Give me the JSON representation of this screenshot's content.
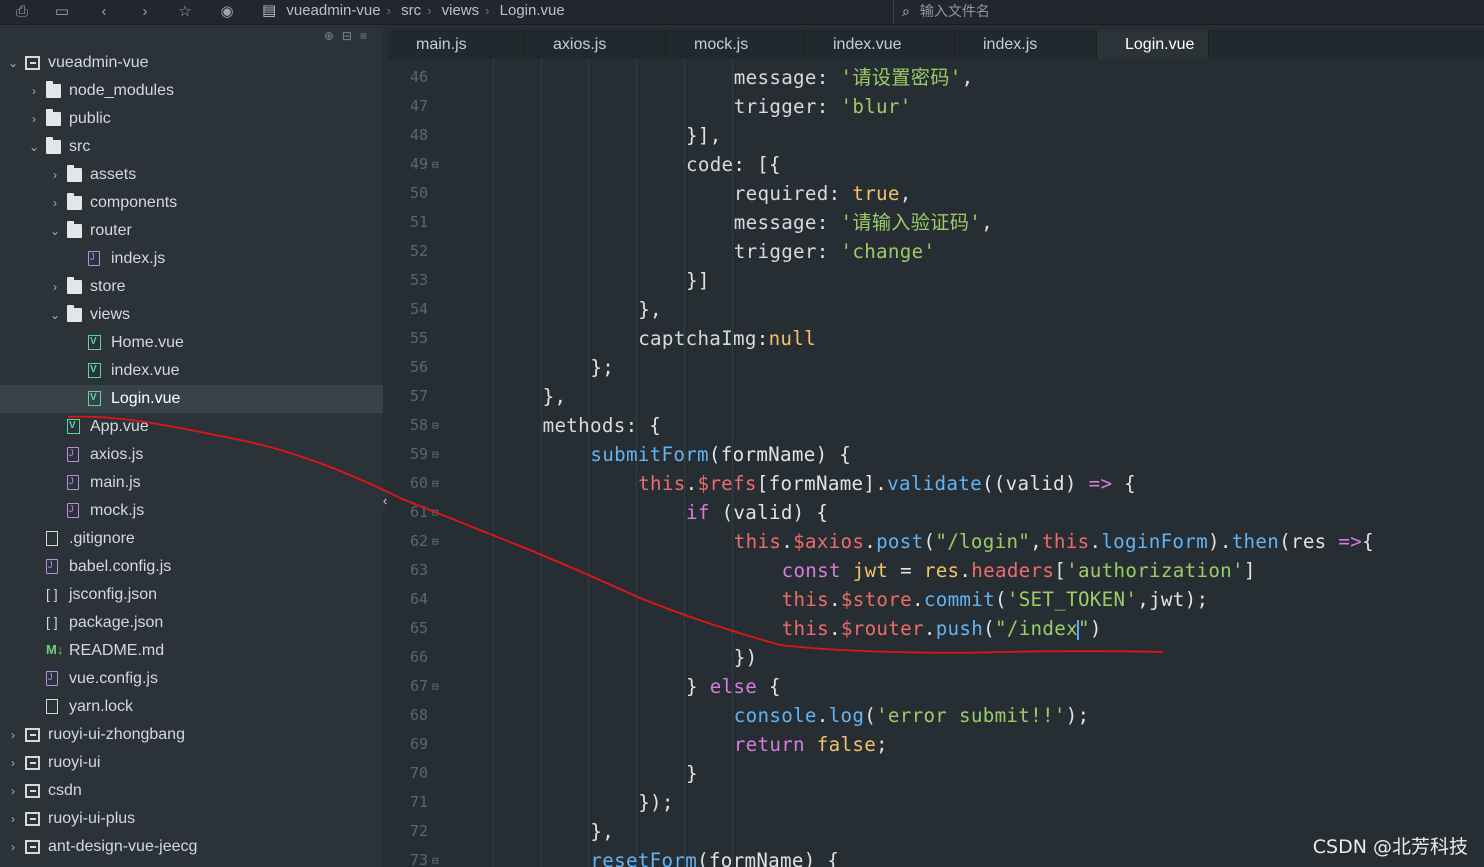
{
  "toolbar": {
    "breadcrumbs": [
      "vueadmin-vue",
      "src",
      "views",
      "Login.vue"
    ],
    "file_search_placeholder": "输入文件名"
  },
  "sidebar": {
    "items": [
      {
        "label": "vueadmin-vue",
        "type": "project",
        "depth": 0,
        "expanded": true
      },
      {
        "label": "node_modules",
        "type": "folder",
        "depth": 1,
        "expanded": false
      },
      {
        "label": "public",
        "type": "folder",
        "depth": 1,
        "expanded": false
      },
      {
        "label": "src",
        "type": "folder",
        "depth": 1,
        "expanded": true
      },
      {
        "label": "assets",
        "type": "folder",
        "depth": 2,
        "expanded": false
      },
      {
        "label": "components",
        "type": "folder",
        "depth": 2,
        "expanded": false
      },
      {
        "label": "router",
        "type": "folder",
        "depth": 2,
        "expanded": true
      },
      {
        "label": "index.js",
        "type": "js",
        "depth": 3
      },
      {
        "label": "store",
        "type": "folder",
        "depth": 2,
        "expanded": false
      },
      {
        "label": "views",
        "type": "folder",
        "depth": 2,
        "expanded": true
      },
      {
        "label": "Home.vue",
        "type": "vue",
        "depth": 3
      },
      {
        "label": "index.vue",
        "type": "vue",
        "depth": 3
      },
      {
        "label": "Login.vue",
        "type": "vue",
        "depth": 3,
        "selected": true
      },
      {
        "label": "App.vue",
        "type": "vue",
        "depth": 2
      },
      {
        "label": "axios.js",
        "type": "js",
        "depth": 2
      },
      {
        "label": "main.js",
        "type": "js",
        "depth": 2
      },
      {
        "label": "mock.js",
        "type": "js",
        "depth": 2
      },
      {
        "label": ".gitignore",
        "type": "file",
        "depth": 1
      },
      {
        "label": "babel.config.js",
        "type": "js",
        "depth": 1
      },
      {
        "label": "jsconfig.json",
        "type": "json",
        "depth": 1
      },
      {
        "label": "package.json",
        "type": "json",
        "depth": 1
      },
      {
        "label": "README.md",
        "type": "md",
        "depth": 1
      },
      {
        "label": "vue.config.js",
        "type": "js",
        "depth": 1
      },
      {
        "label": "yarn.lock",
        "type": "file",
        "depth": 1
      },
      {
        "label": "ruoyi-ui-zhongbang",
        "type": "project",
        "depth": 0,
        "expanded": false
      },
      {
        "label": "ruoyi-ui",
        "type": "project",
        "depth": 0,
        "expanded": false
      },
      {
        "label": "csdn",
        "type": "project",
        "depth": 0,
        "expanded": false
      },
      {
        "label": "ruoyi-ui-plus",
        "type": "project",
        "depth": 0,
        "expanded": false
      },
      {
        "label": "ant-design-vue-jeecg",
        "type": "project",
        "depth": 0,
        "expanded": false
      }
    ]
  },
  "tabs": [
    {
      "label": "main.js",
      "active": false
    },
    {
      "label": "axios.js",
      "active": false
    },
    {
      "label": "mock.js",
      "active": false
    },
    {
      "label": "index.vue",
      "active": false
    },
    {
      "label": "index.js",
      "active": false
    },
    {
      "label": "Login.vue",
      "active": true
    }
  ],
  "editor": {
    "lines": [
      {
        "n": "46",
        "fold": false,
        "indent": 6,
        "tokens": [
          [
            "key",
            "message"
          ],
          [
            "p",
            ": "
          ],
          [
            "str",
            "'请设置密码'"
          ],
          [
            "p",
            ","
          ]
        ]
      },
      {
        "n": "47",
        "fold": false,
        "indent": 6,
        "tokens": [
          [
            "key",
            "trigger"
          ],
          [
            "p",
            ": "
          ],
          [
            "str",
            "'blur'"
          ]
        ]
      },
      {
        "n": "48",
        "fold": false,
        "indent": 5,
        "tokens": [
          [
            "p",
            "}],"
          ]
        ]
      },
      {
        "n": "49",
        "fold": true,
        "indent": 5,
        "tokens": [
          [
            "key",
            "code"
          ],
          [
            "p",
            ": [{"
          ]
        ]
      },
      {
        "n": "50",
        "fold": false,
        "indent": 6,
        "tokens": [
          [
            "key",
            "required"
          ],
          [
            "p",
            ": "
          ],
          [
            "bool",
            "true"
          ],
          [
            "p",
            ","
          ]
        ]
      },
      {
        "n": "51",
        "fold": false,
        "indent": 6,
        "tokens": [
          [
            "key",
            "message"
          ],
          [
            "p",
            ": "
          ],
          [
            "str",
            "'请输入验证码'"
          ],
          [
            "p",
            ","
          ]
        ]
      },
      {
        "n": "52",
        "fold": false,
        "indent": 6,
        "tokens": [
          [
            "key",
            "trigger"
          ],
          [
            "p",
            ": "
          ],
          [
            "str",
            "'change'"
          ]
        ]
      },
      {
        "n": "53",
        "fold": false,
        "indent": 5,
        "tokens": [
          [
            "p",
            "}]"
          ]
        ]
      },
      {
        "n": "54",
        "fold": false,
        "indent": 4,
        "tokens": [
          [
            "p",
            "},"
          ]
        ]
      },
      {
        "n": "55",
        "fold": false,
        "indent": 4,
        "tokens": [
          [
            "key",
            "captchaImg"
          ],
          [
            "p",
            ":"
          ],
          [
            "bool",
            "null"
          ]
        ]
      },
      {
        "n": "56",
        "fold": false,
        "indent": 3,
        "tokens": [
          [
            "p",
            "};"
          ]
        ]
      },
      {
        "n": "57",
        "fold": false,
        "indent": 2,
        "tokens": [
          [
            "p",
            "},"
          ]
        ]
      },
      {
        "n": "58",
        "fold": true,
        "indent": 2,
        "tokens": [
          [
            "key",
            "methods"
          ],
          [
            "p",
            ": {"
          ]
        ]
      },
      {
        "n": "59",
        "fold": true,
        "indent": 3,
        "tokens": [
          [
            "fn",
            "submitForm"
          ],
          [
            "p",
            "(formName) {"
          ]
        ]
      },
      {
        "n": "60",
        "fold": true,
        "indent": 4,
        "tokens": [
          [
            "this",
            "this"
          ],
          [
            "p",
            "."
          ],
          [
            "prop",
            "$refs"
          ],
          [
            "p",
            "[formName]."
          ],
          [
            "fn",
            "validate"
          ],
          [
            "p",
            "((valid) "
          ],
          [
            "kw",
            "=>"
          ],
          [
            "p",
            " {"
          ]
        ]
      },
      {
        "n": "61",
        "fold": true,
        "indent": 5,
        "tokens": [
          [
            "kw",
            "if"
          ],
          [
            "p",
            " (valid) {"
          ]
        ]
      },
      {
        "n": "62",
        "fold": true,
        "indent": 6,
        "tokens": [
          [
            "this",
            "this"
          ],
          [
            "p",
            "."
          ],
          [
            "prop",
            "$axios"
          ],
          [
            "p",
            "."
          ],
          [
            "fn",
            "post"
          ],
          [
            "p",
            "("
          ],
          [
            "str",
            "\"/login\""
          ],
          [
            "p",
            ","
          ],
          [
            "this",
            "this"
          ],
          [
            "p",
            "."
          ],
          [
            "fn",
            "loginForm"
          ],
          [
            "p",
            ")."
          ],
          [
            "fn",
            "then"
          ],
          [
            "p",
            "(res "
          ],
          [
            "kw",
            "=>"
          ],
          [
            "p",
            "{"
          ]
        ]
      },
      {
        "n": "63",
        "fold": false,
        "indent": 7,
        "tokens": [
          [
            "kw",
            "const"
          ],
          [
            "p",
            " "
          ],
          [
            "bool",
            "jwt"
          ],
          [
            "p",
            " = "
          ],
          [
            "bool",
            "res"
          ],
          [
            "p",
            "."
          ],
          [
            "prop",
            "headers"
          ],
          [
            "p",
            "["
          ],
          [
            "str",
            "'authorization'"
          ],
          [
            "p",
            "]"
          ]
        ]
      },
      {
        "n": "64",
        "fold": false,
        "indent": 7,
        "tokens": [
          [
            "this",
            "this"
          ],
          [
            "p",
            "."
          ],
          [
            "prop",
            "$store"
          ],
          [
            "p",
            "."
          ],
          [
            "fn",
            "commit"
          ],
          [
            "p",
            "("
          ],
          [
            "str",
            "'SET_TOKEN'"
          ],
          [
            "p",
            ",jwt);"
          ]
        ]
      },
      {
        "n": "65",
        "fold": false,
        "indent": 7,
        "tokens": [
          [
            "this",
            "this"
          ],
          [
            "p",
            "."
          ],
          [
            "prop",
            "$router"
          ],
          [
            "p",
            "."
          ],
          [
            "fn",
            "push"
          ],
          [
            "p",
            "("
          ],
          [
            "str",
            "\"/index"
          ],
          [
            "cursor",
            ""
          ],
          [
            "str",
            "\""
          ],
          [
            "p",
            ")"
          ]
        ]
      },
      {
        "n": "66",
        "fold": false,
        "indent": 6,
        "tokens": [
          [
            "p",
            "})"
          ]
        ]
      },
      {
        "n": "67",
        "fold": true,
        "indent": 5,
        "tokens": [
          [
            "p",
            "} "
          ],
          [
            "kw",
            "else"
          ],
          [
            "p",
            " {"
          ]
        ]
      },
      {
        "n": "68",
        "fold": false,
        "indent": 6,
        "tokens": [
          [
            "fn",
            "console"
          ],
          [
            "p",
            "."
          ],
          [
            "fn",
            "log"
          ],
          [
            "p",
            "("
          ],
          [
            "str",
            "'error submit!!'"
          ],
          [
            "p",
            ");"
          ]
        ]
      },
      {
        "n": "69",
        "fold": false,
        "indent": 6,
        "tokens": [
          [
            "kw",
            "return"
          ],
          [
            "p",
            " "
          ],
          [
            "bool",
            "false"
          ],
          [
            "p",
            ";"
          ]
        ]
      },
      {
        "n": "70",
        "fold": false,
        "indent": 5,
        "tokens": [
          [
            "p",
            "}"
          ]
        ]
      },
      {
        "n": "71",
        "fold": false,
        "indent": 4,
        "tokens": [
          [
            "p",
            "});"
          ]
        ]
      },
      {
        "n": "72",
        "fold": false,
        "indent": 3,
        "tokens": [
          [
            "p",
            "},"
          ]
        ]
      },
      {
        "n": "73",
        "fold": true,
        "indent": 3,
        "tokens": [
          [
            "fn",
            "resetForm"
          ],
          [
            "p",
            "(formName) {"
          ]
        ]
      }
    ]
  },
  "watermark": "CSDN @北芳科技"
}
